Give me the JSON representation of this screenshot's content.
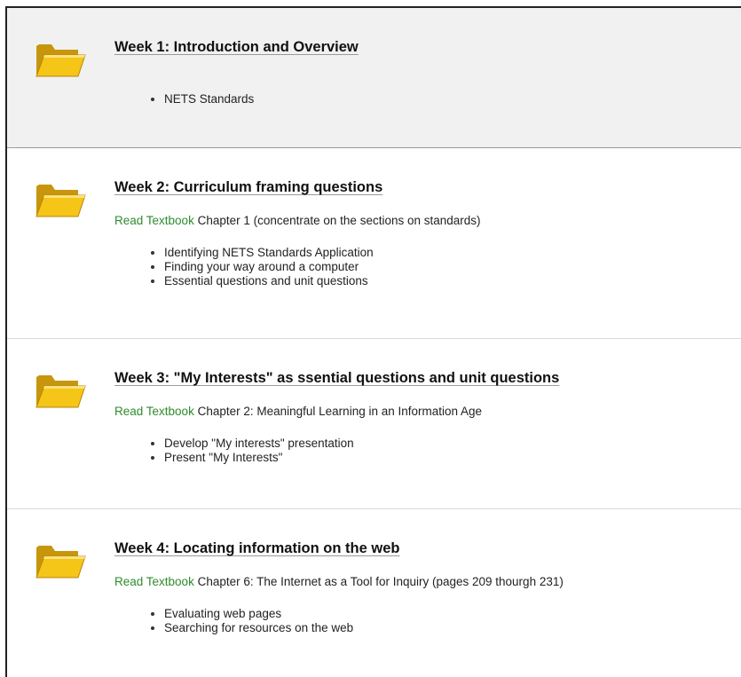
{
  "weeks": [
    {
      "title": "Week 1: Introduction and Overview",
      "reading": null,
      "items": [
        "NETS Standards"
      ],
      "icon": "folder-icon"
    },
    {
      "title": "Week 2: Curriculum framing questions",
      "reading": {
        "link": "Read Textbook",
        "text": " Chapter 1 (concentrate on the sections on standards)"
      },
      "items": [
        "Identifying NETS Standards Application",
        "Finding your way around a computer",
        "Essential questions and unit questions"
      ],
      "icon": "folder-icon"
    },
    {
      "title": "Week 3: \"My Interests\" as ssential questions and unit questions",
      "reading": {
        "link": "Read Textbook",
        "text": " Chapter 2: Meaningful Learning in an Information Age"
      },
      "items": [
        "Develop \"My interests\" presentation",
        "Present \"My Interests\""
      ],
      "icon": "folder-icon"
    },
    {
      "title": "Week 4: Locating information on the web",
      "reading": {
        "link": "Read Textbook",
        "text": " Chapter 6: The Internet as a Tool for Inquiry (pages 209 thourgh 231)"
      },
      "items": [
        "Evaluating web pages",
        "Searching for resources on the web"
      ],
      "icon": "folder-icon"
    }
  ],
  "colors": {
    "link": "#2e8b2e",
    "shaded_row": "#f1f1f1",
    "folder_fill": "#f5c518",
    "folder_dark": "#c8960c"
  }
}
